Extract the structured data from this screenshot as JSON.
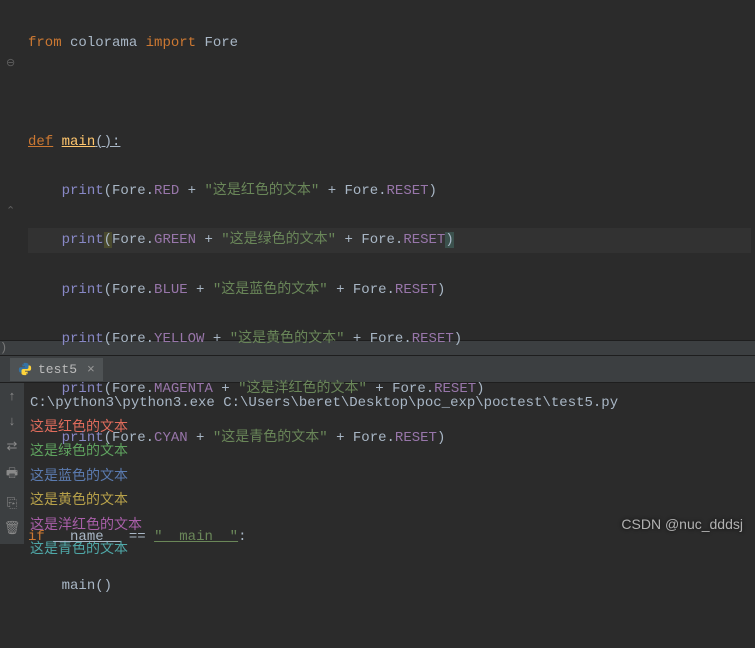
{
  "code": {
    "line1": {
      "from": "from",
      "mod": "colorama",
      "import": "import",
      "name": "Fore"
    },
    "defline": {
      "def": "def",
      "name": "main",
      "suffix": "():"
    },
    "prints": [
      {
        "call": "print",
        "obj": "Fore",
        "color": "RED",
        "str": "\"这是红色的文本\"",
        "reset_obj": "Fore",
        "reset": "RESET"
      },
      {
        "call": "print",
        "obj": "Fore",
        "color": "GREEN",
        "str": "\"这是绿色的文本\"",
        "reset_obj": "Fore",
        "reset": "RESET"
      },
      {
        "call": "print",
        "obj": "Fore",
        "color": "BLUE",
        "str": "\"这是蓝色的文本\"",
        "reset_obj": "Fore",
        "reset": "RESET"
      },
      {
        "call": "print",
        "obj": "Fore",
        "color": "YELLOW",
        "str": "\"这是黄色的文本\"",
        "reset_obj": "Fore",
        "reset": "RESET"
      },
      {
        "call": "print",
        "obj": "Fore",
        "color": "MAGENTA",
        "str": "\"这是洋红色的文本\"",
        "reset_obj": "Fore",
        "reset": "RESET"
      },
      {
        "call": "print",
        "obj": "Fore",
        "color": "CYAN",
        "str": "\"这是青色的文本\"",
        "reset_obj": "Fore",
        "reset": "RESET"
      }
    ],
    "guard": {
      "if": "if",
      "name": "__name__",
      "eq": "==",
      "main": "\"__main__\"",
      "colon": ":",
      "call": "main",
      "paren": "()"
    }
  },
  "divider": ")",
  "tab": {
    "label": "test5"
  },
  "console": {
    "cmd": "C:\\python3\\python3.exe C:\\Users\\beret\\Desktop\\poc_exp\\poctest\\test5.py",
    "lines": [
      {
        "text": "这是红色的文本",
        "cls": "c-red"
      },
      {
        "text": "这是绿色的文本",
        "cls": "c-green"
      },
      {
        "text": "这是蓝色的文本",
        "cls": "c-blue"
      },
      {
        "text": "这是黄色的文本",
        "cls": "c-yellow"
      },
      {
        "text": "这是洋红色的文本",
        "cls": "c-magenta"
      },
      {
        "text": "这是青色的文本",
        "cls": "c-cyan"
      }
    ]
  },
  "watermark": "CSDN @nuc_dddsj"
}
